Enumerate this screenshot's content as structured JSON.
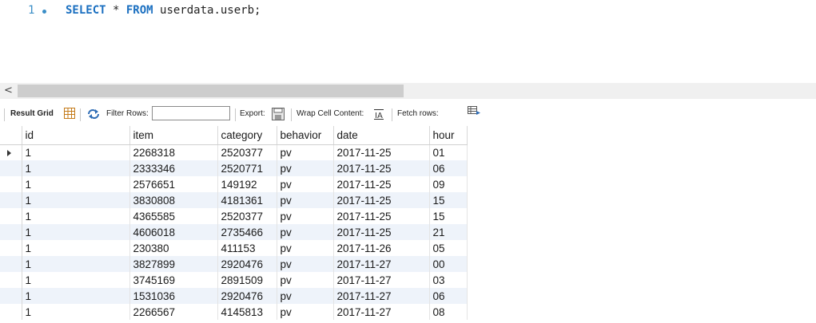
{
  "editor": {
    "line_number": "1",
    "code_keyword1": "SELECT",
    "code_middle": " * ",
    "code_keyword2": "FROM",
    "code_rest": " userdata.userb;"
  },
  "scrollbar": {
    "left_arrow": "<"
  },
  "toolbar": {
    "result_grid_label": "Result Grid",
    "filter_rows_label": "Filter Rows:",
    "filter_rows_value": "",
    "export_label": "Export:",
    "wrap_cell_label": "Wrap Cell Content:",
    "fetch_rows_label": "Fetch rows:"
  },
  "table": {
    "columns": [
      "id",
      "item",
      "category",
      "behavior",
      "date",
      "hour"
    ],
    "rows": [
      [
        "1",
        "2268318",
        "2520377",
        "pv",
        "2017-11-25",
        "01"
      ],
      [
        "1",
        "2333346",
        "2520771",
        "pv",
        "2017-11-25",
        "06"
      ],
      [
        "1",
        "2576651",
        "149192",
        "pv",
        "2017-11-25",
        "09"
      ],
      [
        "1",
        "3830808",
        "4181361",
        "pv",
        "2017-11-25",
        "15"
      ],
      [
        "1",
        "4365585",
        "2520377",
        "pv",
        "2017-11-25",
        "15"
      ],
      [
        "1",
        "4606018",
        "2735466",
        "pv",
        "2017-11-25",
        "21"
      ],
      [
        "1",
        "230380",
        "411153",
        "pv",
        "2017-11-26",
        "05"
      ],
      [
        "1",
        "3827899",
        "2920476",
        "pv",
        "2017-11-27",
        "00"
      ],
      [
        "1",
        "3745169",
        "2891509",
        "pv",
        "2017-11-27",
        "03"
      ],
      [
        "1",
        "1531036",
        "2920476",
        "pv",
        "2017-11-27",
        "06"
      ],
      [
        "1",
        "2266567",
        "4145813",
        "pv",
        "2017-11-27",
        "08"
      ]
    ]
  }
}
